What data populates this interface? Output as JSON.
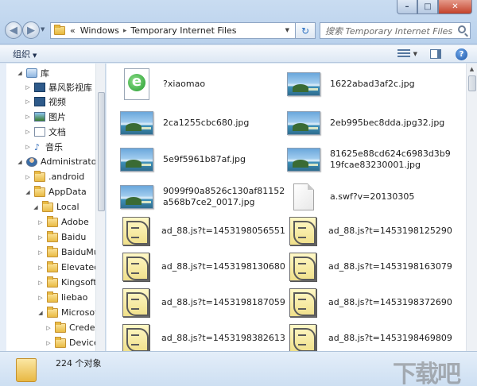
{
  "window": {
    "min_glyph": "–",
    "max_glyph": "□",
    "close_glyph": "✕"
  },
  "address": {
    "prefix": "«",
    "crumbs": [
      "Windows",
      "Temporary Internet Files"
    ],
    "separator": "▸"
  },
  "search": {
    "placeholder": "搜索 Temporary Internet Files"
  },
  "toolbar": {
    "organize_label": "组织",
    "help_glyph": "?"
  },
  "nav_tree": [
    {
      "label": "库",
      "icon": "library-icon",
      "expanded": true
    },
    {
      "label": "暴风影视库",
      "icon": "video-library-icon",
      "expanded": false
    },
    {
      "label": "视频",
      "icon": "video-icon",
      "expanded": false
    },
    {
      "label": "图片",
      "icon": "picture-icon",
      "expanded": false
    },
    {
      "label": "文档",
      "icon": "document-icon",
      "expanded": false
    },
    {
      "label": "音乐",
      "icon": "music-icon",
      "expanded": false
    },
    {
      "label": "Administrator",
      "icon": "user-icon",
      "expanded": true
    },
    {
      "label": ".android",
      "icon": "folder-icon",
      "expanded": false
    },
    {
      "label": "AppData",
      "icon": "folder-icon",
      "expanded": true
    },
    {
      "label": "Local",
      "icon": "folder-icon",
      "expanded": true
    },
    {
      "label": "Adobe",
      "icon": "folder-icon",
      "expanded": false
    },
    {
      "label": "Baidu",
      "icon": "folder-icon",
      "expanded": false
    },
    {
      "label": "BaiduMus",
      "icon": "folder-icon",
      "expanded": false
    },
    {
      "label": "ElevatedD",
      "icon": "folder-icon",
      "expanded": false
    },
    {
      "label": "Kingsoft",
      "icon": "folder-icon",
      "expanded": false
    },
    {
      "label": "liebao",
      "icon": "folder-icon",
      "expanded": false
    },
    {
      "label": "Microsoft",
      "icon": "folder-icon",
      "expanded": true
    },
    {
      "label": "Credenti",
      "icon": "folder-icon",
      "expanded": false
    },
    {
      "label": "Device M",
      "icon": "folder-icon",
      "expanded": false
    }
  ],
  "files": [
    {
      "name": "?xiaomao",
      "icon": "ie-shortcut-icon"
    },
    {
      "name": "1622abad3af2c.jpg",
      "icon": "image-thumbnail-icon"
    },
    {
      "name": "2ca1255cbc680.jpg",
      "icon": "image-thumbnail-icon"
    },
    {
      "name": "2eb995bec8dda.jpg32.jpg",
      "icon": "image-thumbnail-icon"
    },
    {
      "name": "5e9f5961b87af.jpg",
      "icon": "image-thumbnail-icon"
    },
    {
      "name": "81625e88cd624c6983d3b919fcae83230001.jpg",
      "icon": "image-thumbnail-icon"
    },
    {
      "name": "9099f90a8526c130af81152a568b7ce2_0017.jpg",
      "icon": "image-thumbnail-icon"
    },
    {
      "name": "a.swf?v=20130305",
      "icon": "blank-file-icon"
    },
    {
      "name": "ad_88.js?t=1453198056551",
      "icon": "script-file-icon"
    },
    {
      "name": "ad_88.js?t=1453198125290",
      "icon": "script-file-icon"
    },
    {
      "name": "ad_88.js?t=1453198130680",
      "icon": "script-file-icon"
    },
    {
      "name": "ad_88.js?t=1453198163079",
      "icon": "script-file-icon"
    },
    {
      "name": "ad_88.js?t=1453198187059",
      "icon": "script-file-icon"
    },
    {
      "name": "ad_88.js?t=1453198372690",
      "icon": "script-file-icon"
    },
    {
      "name": "ad_88.js?t=1453198382613",
      "icon": "script-file-icon"
    },
    {
      "name": "ad_88.js?t=1453198469809",
      "icon": "script-file-icon"
    }
  ],
  "status": {
    "item_count": "224 个对象"
  }
}
